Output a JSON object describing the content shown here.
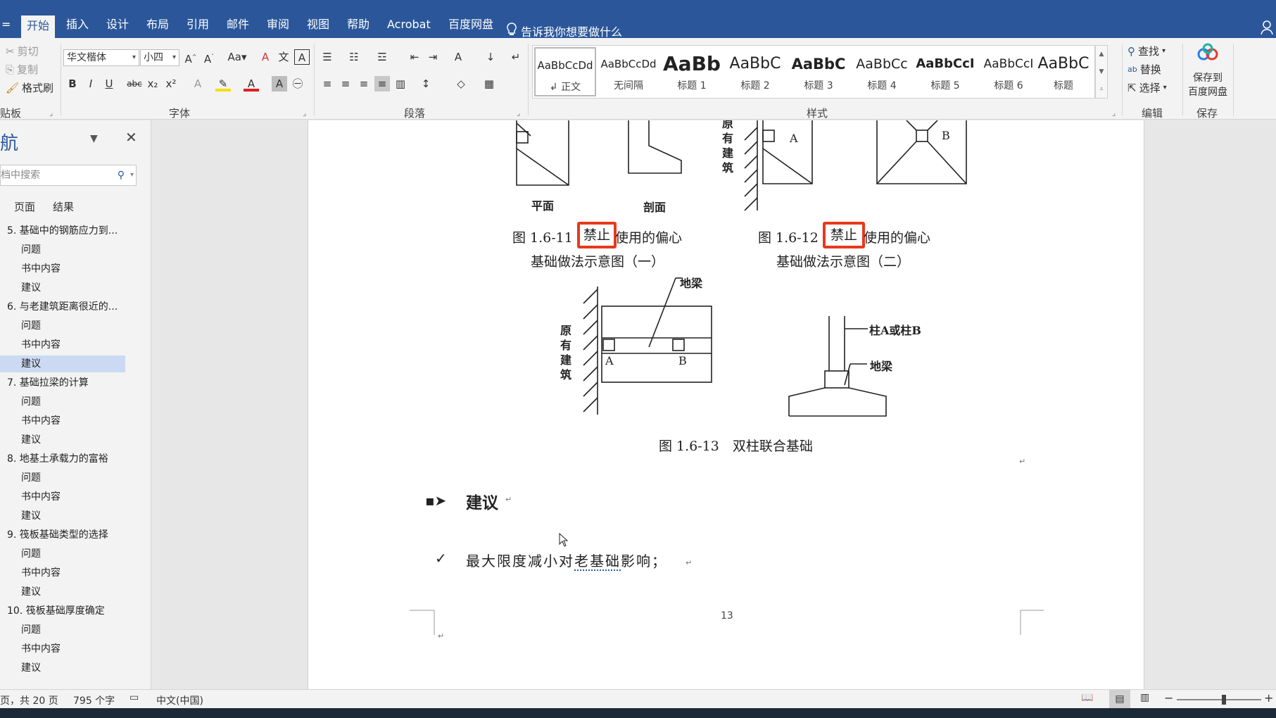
{
  "ribbon_tabs": [
    "开始",
    "插入",
    "设计",
    "布局",
    "引用",
    "邮件",
    "审阅",
    "视图",
    "帮助",
    "Acrobat",
    "百度网盘"
  ],
  "tell_me": "告诉我你想要做什么",
  "clipboard": {
    "cut": "剪切",
    "copy": "复制",
    "format_painter": "格式刷",
    "label": "贴板"
  },
  "font": {
    "name": "华文楷体",
    "size": "小四",
    "label": "字体"
  },
  "paragraph": {
    "label": "段落"
  },
  "styles": {
    "label": "样式",
    "items": [
      {
        "sample": "AaBbCcDd",
        "name": "↲ 正文"
      },
      {
        "sample": "AaBbCcDd",
        "name": "无间隔"
      },
      {
        "sample": "AaBb",
        "name": "标题 1"
      },
      {
        "sample": "AaBbC",
        "name": "标题 2"
      },
      {
        "sample": "AaBbC",
        "name": "标题 3"
      },
      {
        "sample": "AaBbCc",
        "name": "标题 4"
      },
      {
        "sample": "AaBbCcI",
        "name": "标题 5"
      },
      {
        "sample": "AaBbCcI",
        "name": "标题 6"
      },
      {
        "sample": "AaBbC",
        "name": "标题"
      }
    ]
  },
  "editing": {
    "find": "查找",
    "replace": "替换",
    "select": "选择",
    "label": "编辑"
  },
  "save_cloud": {
    "line1": "保存到",
    "line2": "百度网盘",
    "label": "保存"
  },
  "nav": {
    "title": "航",
    "search_placeholder": "档中搜索",
    "tab_pages": "页面",
    "tab_results": "结果",
    "items": [
      {
        "text": "5. 基础中的钢筋应力到...",
        "level": 1
      },
      {
        "text": "问题",
        "level": 2
      },
      {
        "text": "书中内容",
        "level": 2
      },
      {
        "text": "建议",
        "level": 2
      },
      {
        "text": "6. 与老建筑距离很近的...",
        "level": 1
      },
      {
        "text": "问题",
        "level": 2
      },
      {
        "text": "书中内容",
        "level": 2
      },
      {
        "text": "建议",
        "level": 2,
        "selected": true
      },
      {
        "text": "7. 基础拉梁的计算",
        "level": 1
      },
      {
        "text": "问题",
        "level": 2
      },
      {
        "text": "书中内容",
        "level": 2
      },
      {
        "text": "建议",
        "level": 2
      },
      {
        "text": "8. 地基土承载力的富裕",
        "level": 1
      },
      {
        "text": "问题",
        "level": 2
      },
      {
        "text": "书中内容",
        "level": 2
      },
      {
        "text": "建议",
        "level": 2
      },
      {
        "text": "9. 筏板基础类型的选择",
        "level": 1
      },
      {
        "text": "问题",
        "level": 2
      },
      {
        "text": "书中内容",
        "level": 2
      },
      {
        "text": "建议",
        "level": 2
      },
      {
        "text": "10. 筏板基础厚度确定",
        "level": 1
      },
      {
        "text": "问题",
        "level": 2
      },
      {
        "text": "书中内容",
        "level": 2
      },
      {
        "text": "建议",
        "level": 2
      }
    ]
  },
  "doc": {
    "label_plan": "平面",
    "label_section": "剖面",
    "label_A": "A",
    "label_B": "B",
    "label_existing": [
      "原",
      "有",
      "建",
      "筑"
    ],
    "fig11_prefix": "图 1.6-11",
    "fig11_forbid": "禁止",
    "fig11_suffix": "使用的偏心",
    "fig11_line2": "基础做法示意图（一）",
    "fig12_prefix": "图 1.6-12",
    "fig12_forbid": "禁止",
    "fig12_suffix": "使用的偏心",
    "fig12_line2": "基础做法示意图（二）",
    "label_ground_beam": "地梁",
    "label_column": "柱A或柱B",
    "fig13_caption": "图 1.6-13　双柱联合基础",
    "heading": "建议",
    "bullet_text_a": "最大限度减小对",
    "bullet_text_b": "老基础",
    "bullet_text_c": "影响；",
    "page_number": "13"
  },
  "status": {
    "pages": "页，共 20 页",
    "words": "795 个字",
    "language": "中文(中国)"
  },
  "colors": {
    "accent": "#2b579a",
    "highlight_box": "#e8391c",
    "nav_selected": "#cbdaf2"
  }
}
